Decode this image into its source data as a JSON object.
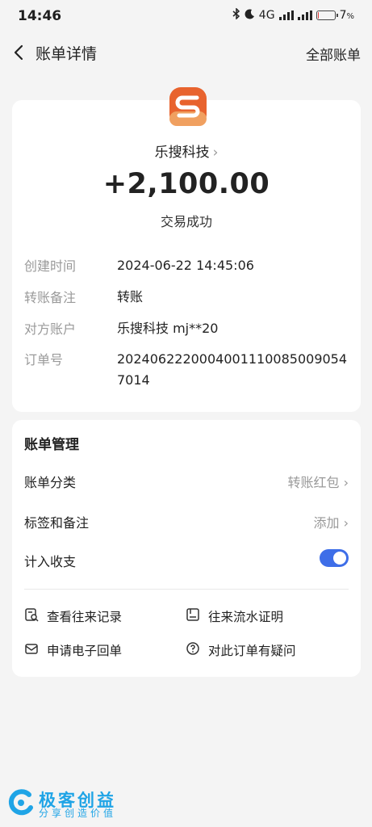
{
  "status_bar": {
    "time": "14:46",
    "network": "4G",
    "battery_text": "7",
    "battery_unit": "%",
    "battery_level": 0.07
  },
  "header": {
    "title": "账单详情",
    "all_bills": "全部账单"
  },
  "detail": {
    "merchant": "乐搜科技",
    "amount": "+2,100.00",
    "status": "交易成功",
    "rows": [
      {
        "label": "创建时间",
        "value": "2024-06-22 14:45:06"
      },
      {
        "label": "转账备注",
        "value": "转账"
      },
      {
        "label": "对方账户",
        "value": "乐搜科技 mj**20"
      },
      {
        "label": "订单号",
        "value": "20240622200040011100850090547014"
      }
    ]
  },
  "management": {
    "title": "账单管理",
    "category_label": "账单分类",
    "category_value": "转账红包",
    "tags_label": "标签和备注",
    "tags_value": "添加",
    "count_label": "计入收支",
    "count_enabled": true,
    "actions": {
      "records": "查看往来记录",
      "proof": "往来流水证明",
      "receipt": "申请电子回单",
      "question": "对此订单有疑问"
    }
  },
  "watermark": {
    "brand": "极客创益",
    "tagline": "分享创造价值"
  },
  "colors": {
    "accent": "#3e6ee8",
    "logo_orange": "#e8632e",
    "watermark": "#1fa4e6"
  }
}
